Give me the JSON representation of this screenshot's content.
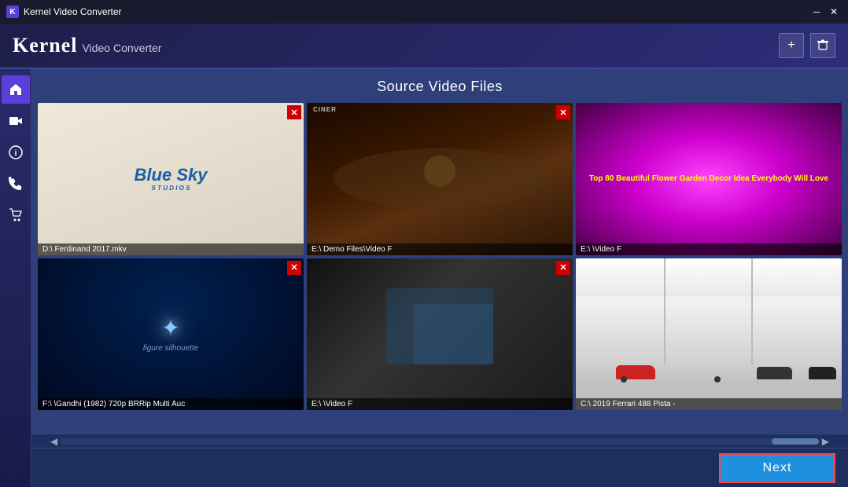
{
  "titleBar": {
    "title": "Kernel Video Converter",
    "appIcon": "K",
    "minimizeBtn": "─",
    "closeBtn": "✕"
  },
  "header": {
    "logoKernel": "Kernel",
    "logoSubtitle": "Video Converter",
    "addBtn": "+",
    "deleteBtn": "🗑"
  },
  "sidebar": {
    "items": [
      {
        "id": "home",
        "icon": "⌂",
        "active": true
      },
      {
        "id": "video",
        "icon": "▶"
      },
      {
        "id": "info",
        "icon": "ℹ"
      },
      {
        "id": "phone",
        "icon": "📞"
      },
      {
        "id": "cart",
        "icon": "🛒"
      }
    ]
  },
  "main": {
    "sectionTitle": "Source Video Files",
    "videos": [
      {
        "id": "video-1",
        "type": "bluesky",
        "label": "D:\\  Ferdinand 2017.mkv",
        "hasClose": true
      },
      {
        "id": "video-2",
        "type": "cinema",
        "label": "E:\\  Demo Files\\Video F",
        "hasClose": true,
        "overlayText": "CINER"
      },
      {
        "id": "video-3",
        "type": "flower",
        "label": "E:\\  \\Video F",
        "hasClose": false,
        "flowerText": "Top 80 Beautiful Flower Garden Decor Idea Everybody Will Love"
      },
      {
        "id": "video-4",
        "type": "gandhi",
        "label": "F:\\  \\Gandhi (1982) 720p BRRip Multi Auc",
        "hasClose": true
      },
      {
        "id": "video-5",
        "type": "dark",
        "label": "E:\\  \\Video F",
        "hasClose": true
      },
      {
        "id": "video-6",
        "type": "garage",
        "label": "C:\\  2019 Ferrari 488 Pista -",
        "hasClose": false
      }
    ]
  },
  "footer": {
    "nextBtn": "Next"
  },
  "colors": {
    "accent": "#1e90dd",
    "danger": "#ff4444",
    "sidebar": "#2a2a6a"
  }
}
